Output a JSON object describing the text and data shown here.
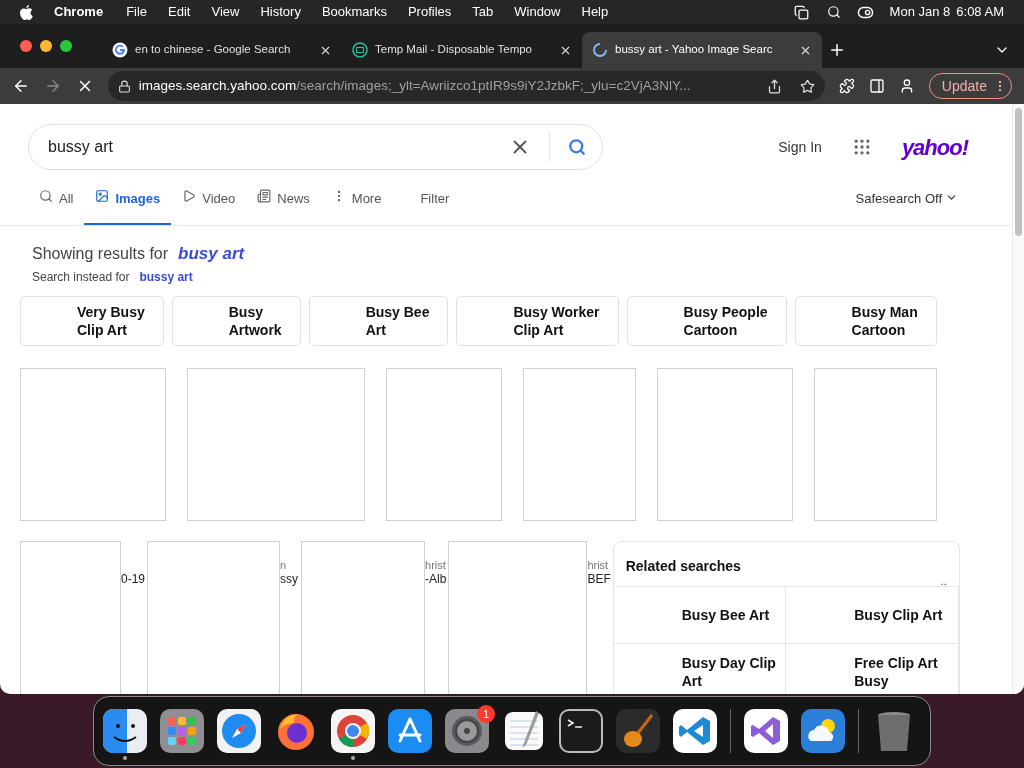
{
  "menubar": {
    "app": "Chrome",
    "menus": [
      "File",
      "Edit",
      "View",
      "History",
      "Bookmarks",
      "Profiles",
      "Tab",
      "Window",
      "Help"
    ],
    "date": "Mon Jan 8",
    "time": "6:08 AM"
  },
  "tabs": [
    {
      "title": "en to chinese - Google Search",
      "kind": "google",
      "selected": false
    },
    {
      "title": "Temp Mail - Disposable Tempo",
      "kind": "mail",
      "selected": false
    },
    {
      "title": "bussy art - Yahoo Image Searc",
      "kind": "loading",
      "selected": true
    }
  ],
  "toolbar": {
    "domain": "images.search.yahoo.com",
    "path": "/search/images;_ylt=Awriizco1ptIR9s9iY2JzbkF;_ylu=c2VjA3NlY...",
    "update": "Update"
  },
  "search": {
    "value": "bussy art"
  },
  "sign_in": "Sign In",
  "logo": "yahoo!",
  "nav": [
    {
      "label": "All",
      "kind": "all",
      "selected": false
    },
    {
      "label": "Images",
      "kind": "images",
      "selected": true
    },
    {
      "label": "Video",
      "kind": "video",
      "selected": false
    },
    {
      "label": "News",
      "kind": "news",
      "selected": false
    },
    {
      "label": "More",
      "kind": "more",
      "selected": false
    }
  ],
  "filter": "Filter",
  "safesearch": "Safesearch Off",
  "correction": {
    "prefix": "Showing results for",
    "term": "busy art",
    "alt_prefix": "Search instead for",
    "alt_term": "bussy art"
  },
  "chips": [
    {
      "lines": [
        "Very Busy",
        "Clip Art"
      ]
    },
    {
      "lines": [
        "Busy",
        "Artwork"
      ]
    },
    {
      "lines": [
        "Busy Bee",
        "Art"
      ]
    },
    {
      "lines": [
        "Busy Worker",
        "Clip Art"
      ]
    },
    {
      "lines": [
        "Busy People",
        "Cartoon"
      ]
    },
    {
      "lines": [
        "Busy Man",
        "Cartoon"
      ]
    }
  ],
  "results_row_2": [
    {
      "caption_bottom": "0-19"
    },
    {
      "caption_top": "n",
      "caption_bottom": "ssy"
    },
    {
      "caption_top": "hrist",
      "caption_bottom": "-Alb"
    },
    {
      "caption_top": "hrist",
      "caption_bottom": "BEF"
    }
  ],
  "related": {
    "title": "Related searches",
    "more": "..",
    "items": [
      {
        "lines": [
          "Busy Bee Art"
        ]
      },
      {
        "lines": [
          "Busy Clip Art"
        ]
      },
      {
        "lines": [
          "Busy Day Clip",
          "Art"
        ]
      },
      {
        "lines": [
          "Free Clip Art",
          "Busy"
        ]
      }
    ]
  },
  "dock": [
    {
      "kind": "finder",
      "running": true
    },
    {
      "kind": "launchpad",
      "running": false
    },
    {
      "kind": "safari",
      "running": false
    },
    {
      "kind": "firefox",
      "running": false
    },
    {
      "kind": "chrome",
      "running": true
    },
    {
      "kind": "appstore",
      "running": false
    },
    {
      "kind": "settings",
      "running": false,
      "badge": "1"
    },
    {
      "kind": "textedit",
      "running": false
    },
    {
      "kind": "terminal",
      "running": false
    },
    {
      "kind": "garageband",
      "running": false
    },
    {
      "kind": "vscode",
      "running": false
    },
    {
      "kind": "separator"
    },
    {
      "kind": "visualstudio",
      "running": false
    },
    {
      "kind": "weather",
      "running": false
    },
    {
      "kind": "separator"
    },
    {
      "kind": "trash",
      "running": false
    }
  ]
}
